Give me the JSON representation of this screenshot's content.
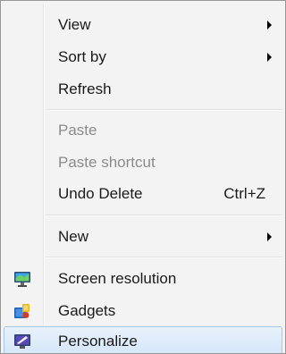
{
  "menu": {
    "items": [
      {
        "label": "View",
        "submenu": true
      },
      {
        "label": "Sort by",
        "submenu": true
      },
      {
        "label": "Refresh"
      },
      {
        "label": "Paste",
        "disabled": true
      },
      {
        "label": "Paste shortcut",
        "disabled": true
      },
      {
        "label": "Undo Delete",
        "shortcut": "Ctrl+Z"
      },
      {
        "label": "New",
        "submenu": true
      },
      {
        "label": "Screen resolution",
        "icon": "monitor-icon"
      },
      {
        "label": "Gadgets",
        "icon": "gadgets-icon"
      },
      {
        "label": "Personalize",
        "icon": "personalize-icon",
        "highlighted": true
      }
    ]
  },
  "colors": {
    "menu_background": "#f3f3f3",
    "menu_border": "#979797",
    "disabled_text": "#8b8b8b",
    "highlight": "#d4e6f9"
  }
}
